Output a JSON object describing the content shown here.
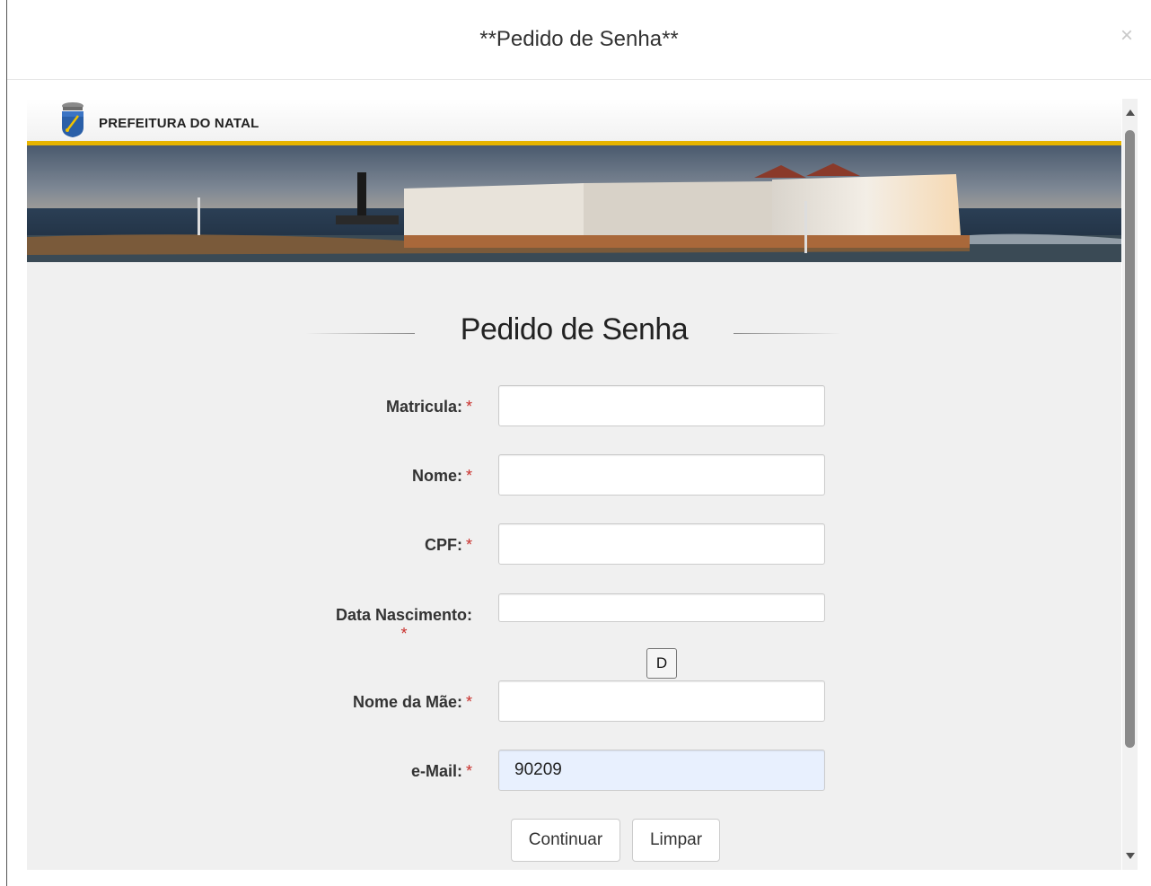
{
  "modal": {
    "title": "**Pedido de Senha**",
    "close_label": "×"
  },
  "brand": {
    "name": "PREFEITURA DO NATAL",
    "logo_icon": "city-crest-icon"
  },
  "form": {
    "heading": "Pedido de Senha",
    "required_marker": "*",
    "fields": [
      {
        "label": "Matricula:",
        "value": "",
        "placeholder": ""
      },
      {
        "label": "Nome:",
        "value": "",
        "placeholder": ""
      },
      {
        "label": "CPF:",
        "value": "",
        "placeholder": ""
      },
      {
        "label": "Data Nascimento:",
        "value": "",
        "placeholder": ""
      },
      {
        "label": "Nome da Mãe:",
        "value": "",
        "placeholder": ""
      },
      {
        "label": "e-Mail:",
        "value": "90209",
        "placeholder": ""
      }
    ],
    "date_button": "D",
    "buttons": {
      "continue": "Continuar",
      "clear": "Limpar"
    }
  },
  "colors": {
    "accent_bar": "#e7b400",
    "required": "#c9302c",
    "autofill": "#e8f0fe",
    "panel_bg": "#f0f0f0"
  }
}
